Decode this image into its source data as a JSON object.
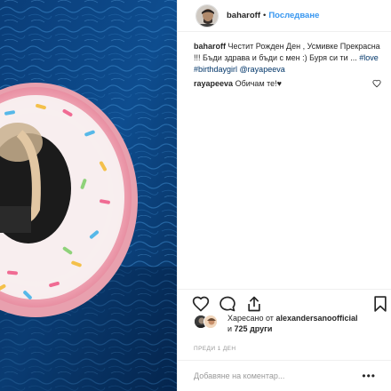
{
  "post": {
    "author": "baharoff",
    "separator": "•",
    "follow_label": "Последване"
  },
  "comments": [
    {
      "author": "baharoff",
      "text_before": "Честит Рожден Ден , Усмивке Прекрасна !!! Бъди здрава и бъди с мен :) Буря си ти ... ",
      "tag1": "#love",
      "sep": " ",
      "tag2": "#birthdaygirl",
      "sep2": " ",
      "tag3": "@rayapeeva"
    },
    {
      "author": "rayapeeva",
      "text": "Обичам те!♥"
    }
  ],
  "likes": {
    "prefix": "Харесано от",
    "user": "alexandersanoofficial",
    "suffix_and": "и",
    "others": "725 други"
  },
  "time": "ПРЕДИ 1 ДЕН",
  "add_comment": {
    "placeholder": "Добавяне на коментар..."
  },
  "more_label": "•••",
  "icons": [
    "heart-icon",
    "comment-icon",
    "share-icon",
    "bookmark-icon"
  ],
  "colors": {
    "accent": "#3897f0",
    "hashtag": "#003569",
    "pool": "#0d3b66"
  }
}
